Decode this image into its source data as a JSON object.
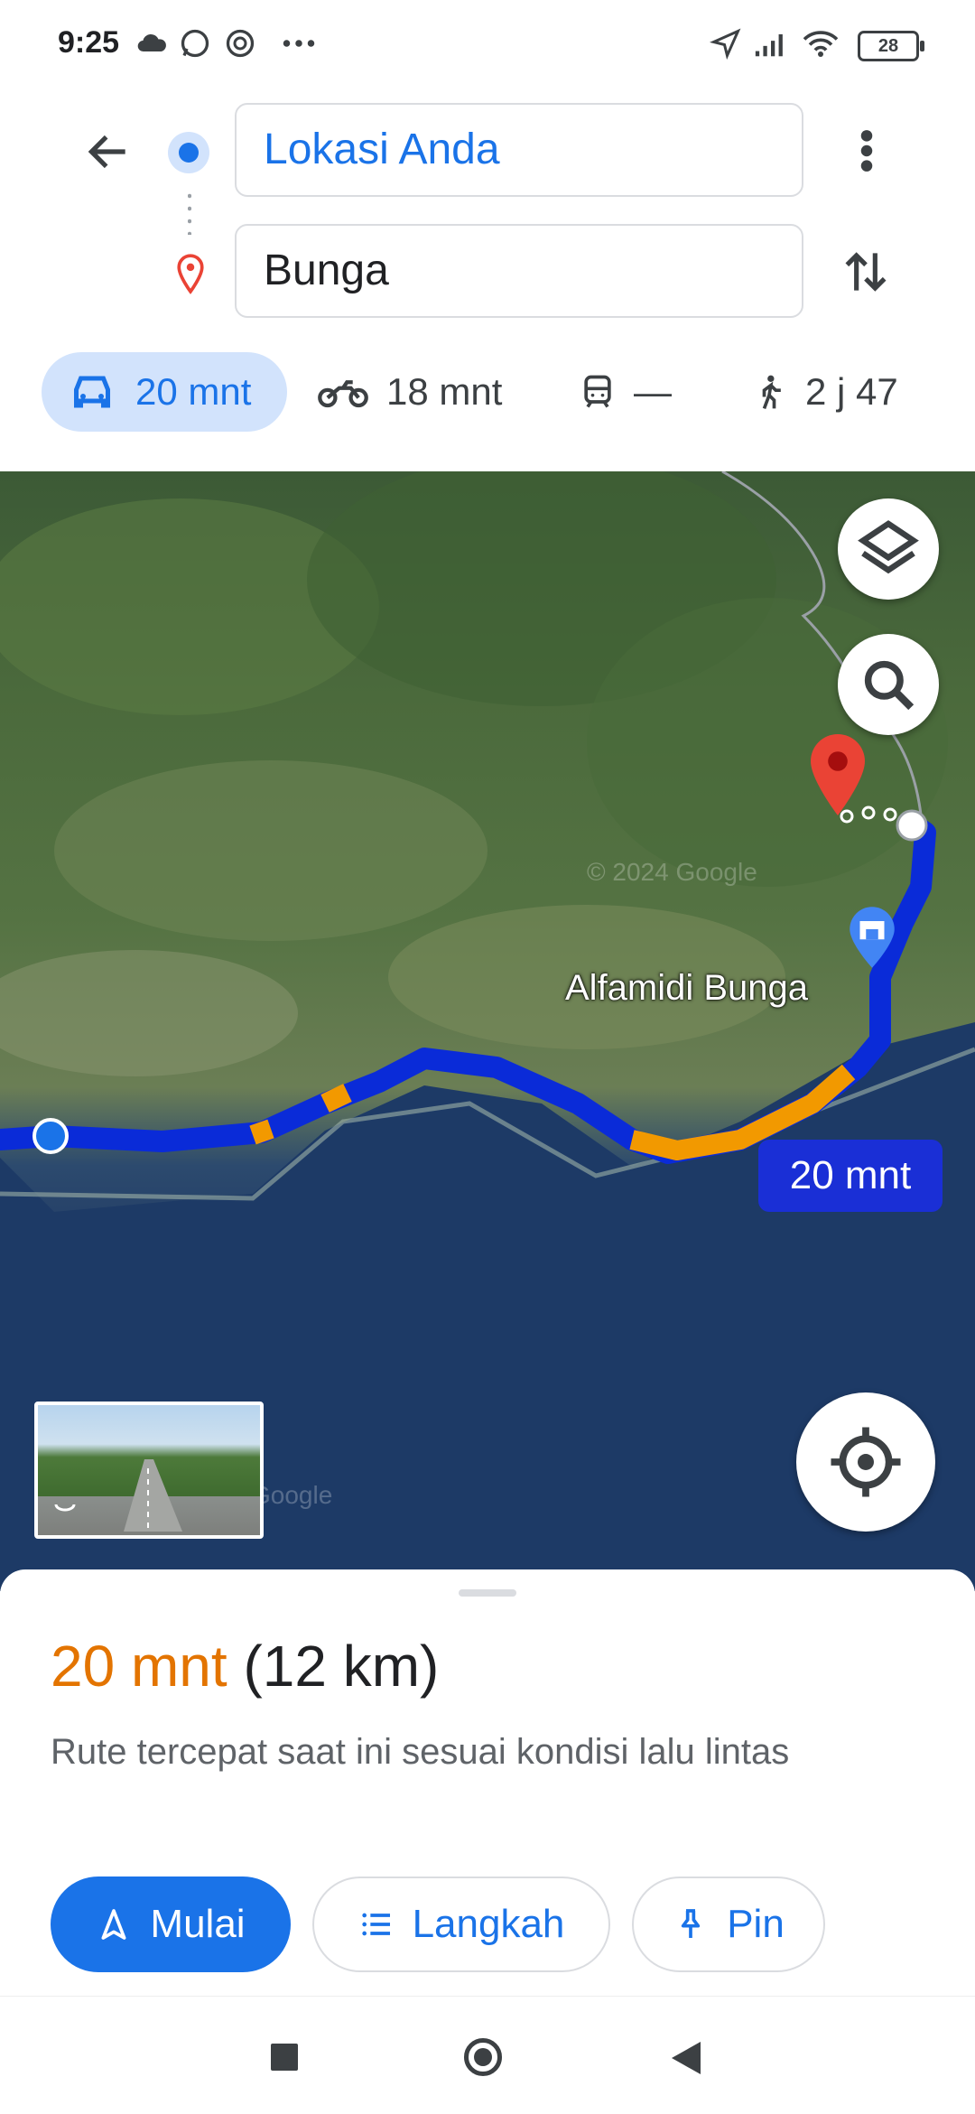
{
  "status_bar": {
    "time": "9:25",
    "battery": "28"
  },
  "directions": {
    "origin": "Lokasi Anda",
    "destination": "Bunga"
  },
  "modes": [
    {
      "name": "car",
      "label": "20 mnt"
    },
    {
      "name": "motorcycle",
      "label": "18 mnt"
    },
    {
      "name": "transit",
      "label": "—"
    },
    {
      "name": "walk",
      "label": "2 j 47"
    }
  ],
  "map": {
    "place_label": "Alfamidi Bunga",
    "route_eta": "20 mnt",
    "watermark": "© 2024 Google",
    "watermark2": "Google"
  },
  "summary": {
    "duration": "20 mnt",
    "distance": "(12 km)",
    "description": "Rute tercepat saat ini sesuai kondisi lalu lintas"
  },
  "actions": {
    "start": "Mulai",
    "steps": "Langkah",
    "pin": "Pin"
  },
  "colors": {
    "accent": "#1a73e8",
    "eta": "#e37400",
    "route": "#1a2fd6",
    "traffic": "#f29900"
  }
}
